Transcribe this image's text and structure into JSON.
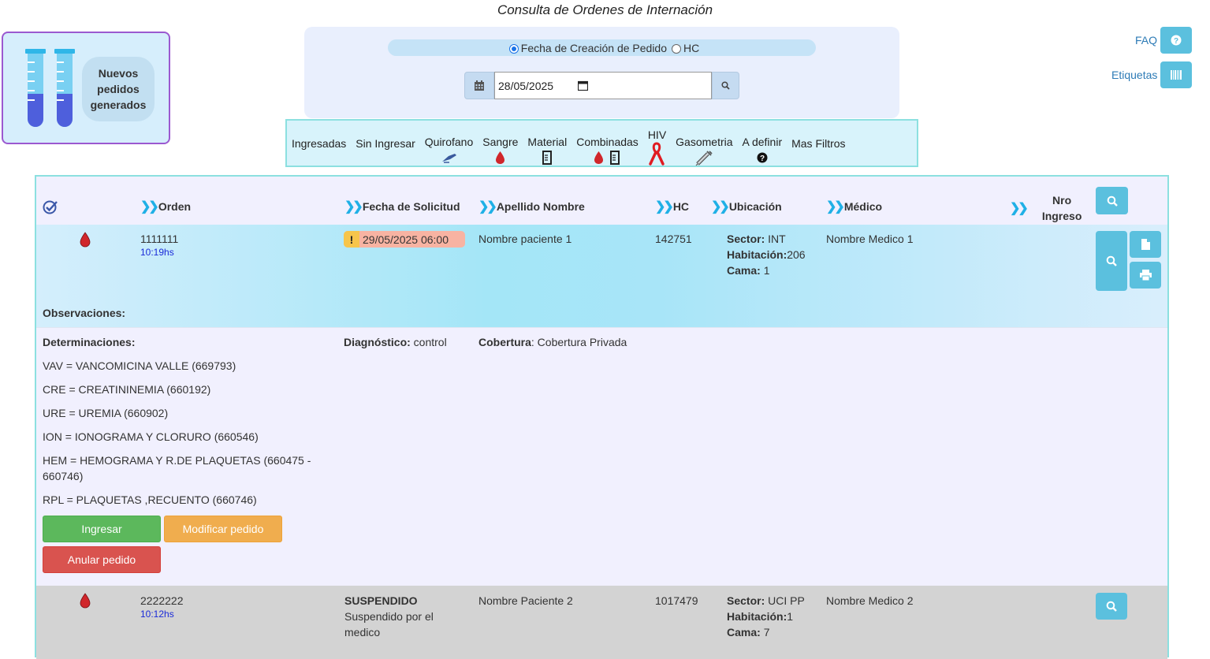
{
  "page": {
    "title": "Consulta de Ordenes de Internación"
  },
  "widget": {
    "label_line1": "Nuevos",
    "label_line2": "pedidos",
    "label_line3": "generados"
  },
  "filter": {
    "radio_fecha": "Fecha de Creación de Pedido",
    "radio_hc": "HC",
    "date_value": "28/05/2025"
  },
  "toplinks": {
    "faq": "FAQ",
    "etiquetas": "Etiquetas"
  },
  "tabs": [
    {
      "label": "Ingresadas"
    },
    {
      "label": "Sin Ingresar"
    },
    {
      "label": "Quirofano"
    },
    {
      "label": "Sangre"
    },
    {
      "label": "Material"
    },
    {
      "label": "Combinadas"
    },
    {
      "label": "HIV"
    },
    {
      "label": "Gasometria"
    },
    {
      "label": "A definir"
    },
    {
      "label": "Mas Filtros"
    }
  ],
  "table": {
    "headers": {
      "orden": "Orden",
      "fecha": "Fecha de Solicitud",
      "apellido": "Apellido Nombre",
      "hc": "HC",
      "ubicacion": "Ubicación",
      "medico": "Médico",
      "nro_ingreso_1": "Nro",
      "nro_ingreso_2": "Ingreso"
    },
    "rows": [
      {
        "orden": "1111111",
        "hora": "10:19hs",
        "fecha": "29/05/2025 06:00",
        "paciente": "Nombre paciente 1",
        "hc": "142751",
        "sector_label": "Sector:",
        "sector": "INT",
        "habitacion_label": "Habitación:",
        "habitacion": "206",
        "cama_label": "Cama:",
        "cama": "1",
        "medico": "Nombre Medico 1",
        "observaciones_label": "Observaciones:",
        "determinaciones_label": "Determinaciones:",
        "diagnostico_label": "Diagnóstico:",
        "diagnostico": "control",
        "cobertura_label": "Cobertura",
        "cobertura": ": Cobertura Privada",
        "determinaciones": [
          "VAV = VANCOMICINA VALLE (669793)",
          "CRE = CREATININEMIA (660192)",
          "URE = UREMIA (660902)",
          "ION = IONOGRAMA Y CLORURO (660546)",
          "HEM = HEMOGRAMA Y R.DE PLAQUETAS (660475 -",
          "660746)",
          "RPL = PLAQUETAS ,RECUENTO (660746)"
        ],
        "btn_ingresar": "Ingresar",
        "btn_modificar": "Modificar pedido",
        "btn_anular": "Anular pedido"
      },
      {
        "orden": "2222222",
        "hora": "10:12hs",
        "estado": "SUSPENDIDO",
        "estado_detalle_1": "Suspendido por el",
        "estado_detalle_2": "medico",
        "paciente": "Nombre Paciente 2",
        "hc": "1017479",
        "sector_label": "Sector:",
        "sector": "UCI PP",
        "habitacion_label": "Habitación:",
        "habitacion": "1",
        "cama_label": "Cama:",
        "cama": "7",
        "medico": "Nombre Medico 2"
      }
    ]
  },
  "colors": {
    "accent": "#5bc0de",
    "border": "#8ce0e0",
    "blood": "#d0262b",
    "purple_border": "#9b59d0"
  },
  "icons": [
    "test-tubes-icon",
    "calendar-icon",
    "search-icon",
    "question-icon",
    "barcode-icon",
    "scalpel-icon",
    "blood-drop-icon",
    "beaker-icon",
    "ribbon-icon",
    "syringe-icon",
    "question-circle-icon",
    "check-all-icon",
    "file-icon",
    "print-icon",
    "warning-icon"
  ]
}
